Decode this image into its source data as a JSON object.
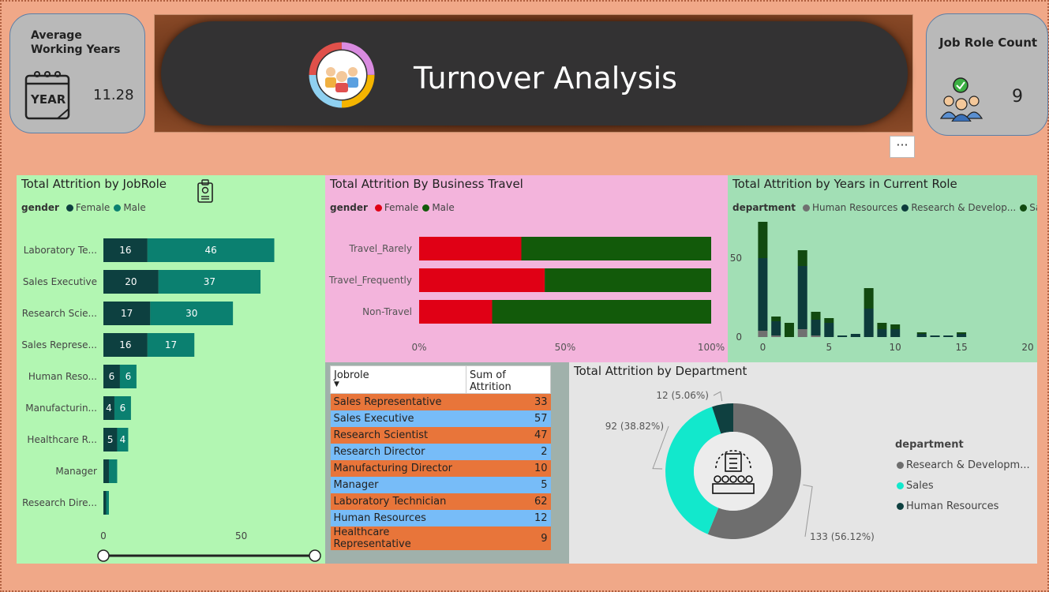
{
  "header": {
    "title": "Turnover Analysis",
    "more_label": "···"
  },
  "kpis": {
    "avg_years": {
      "label": "Average Working Years",
      "value": "11.28",
      "icon": "year-calendar-icon",
      "icon_text": "YEAR"
    },
    "job_role_count": {
      "label": "Job Role Count",
      "value": "9",
      "icon": "team-check-icon"
    }
  },
  "jobrole_chart": {
    "title": "Total Attrition by JobRole",
    "legend_title": "gender",
    "legend": [
      "Female",
      "Male"
    ],
    "colors": {
      "female": "#0d4040",
      "male": "#0b8070",
      "bg": "#b2f6b2"
    }
  },
  "travel_chart": {
    "title": "Total Attrition By Business Travel",
    "legend_title": "gender",
    "legend": [
      "Female",
      "Male"
    ],
    "colors": {
      "female": "#e00015",
      "male": "#125a0a",
      "bg": "#f3b4dc"
    }
  },
  "years_chart": {
    "title": "Total Attrition by Years in Current Role",
    "legend_title": "department",
    "legend": [
      "Human Resources",
      "Research & Develop...",
      "Sales"
    ],
    "colors": {
      "hr": "#707070",
      "rd": "#0d3b3b",
      "sales": "#124a10",
      "bg": "#a2dfb5"
    }
  },
  "table": {
    "headers": [
      "Jobrole",
      "Sum of Attrition"
    ],
    "rows": [
      [
        "Sales Representative",
        "33"
      ],
      [
        "Sales Executive",
        "57"
      ],
      [
        "Research Scientist",
        "47"
      ],
      [
        "Research Director",
        "2"
      ],
      [
        "Manufacturing Director",
        "10"
      ],
      [
        "Manager",
        "5"
      ],
      [
        "Laboratory Technician",
        "62"
      ],
      [
        "Human Resources",
        "12"
      ],
      [
        "Healthcare Representative",
        "9"
      ]
    ]
  },
  "dept_chart": {
    "title": "Total Attrition by Department",
    "legend_title": "department",
    "legend": [
      "Research & Developm...",
      "Sales",
      "Human Resources"
    ],
    "colors": {
      "rd": "#6e6e6e",
      "sales": "#12e8cc",
      "hr": "#0f4040",
      "bg": "#e5e5e5"
    }
  },
  "chart_data": [
    {
      "type": "bar",
      "orientation": "horizontal",
      "stacked": true,
      "title": "Total Attrition by JobRole",
      "categories": [
        "Laboratory Te...",
        "Sales Executive",
        "Research Scie...",
        "Sales Represe...",
        "Human Reso...",
        "Manufacturin...",
        "Healthcare R...",
        "Manager",
        "Research Dire..."
      ],
      "series": [
        {
          "name": "Female",
          "values": [
            16,
            20,
            17,
            16,
            6,
            4,
            5,
            2,
            1
          ]
        },
        {
          "name": "Male",
          "values": [
            46,
            37,
            30,
            17,
            6,
            6,
            4,
            3,
            1
          ]
        }
      ],
      "data_labels": [
        [
          "16",
          "46"
        ],
        [
          "20",
          "37"
        ],
        [
          "17",
          "30"
        ],
        [
          "16",
          "17"
        ],
        [
          "6",
          "6"
        ],
        [
          "4",
          "6"
        ],
        [
          "5",
          "4"
        ],
        [
          "",
          ""
        ],
        [
          "",
          ""
        ]
      ],
      "xticks": [
        "0",
        "50"
      ],
      "xlim": [
        0,
        63
      ]
    },
    {
      "type": "bar",
      "orientation": "horizontal",
      "stacked": "percent",
      "title": "Total Attrition By Business Travel",
      "categories": [
        "Travel_Rarely",
        "Travel_Frequently",
        "Non-Travel"
      ],
      "series": [
        {
          "name": "Female",
          "values": [
            35,
            43,
            25
          ]
        },
        {
          "name": "Male",
          "values": [
            65,
            57,
            75
          ]
        }
      ],
      "xticks": [
        "0%",
        "50%",
        "100%"
      ]
    },
    {
      "type": "bar",
      "stacked": true,
      "title": "Total Attrition by Years in Current Role",
      "x": [
        0,
        1,
        2,
        3,
        4,
        5,
        6,
        7,
        8,
        9,
        10,
        12,
        13,
        14,
        15
      ],
      "series": [
        {
          "name": "Human Resources",
          "values": [
            4,
            1,
            0,
            5,
            1,
            0,
            0,
            0,
            0,
            0,
            0,
            0,
            0,
            0,
            0
          ]
        },
        {
          "name": "Research & Develop...",
          "values": [
            46,
            9,
            0,
            40,
            10,
            9,
            1,
            2,
            18,
            5,
            5,
            2,
            1,
            1,
            2
          ]
        },
        {
          "name": "Sales",
          "values": [
            23,
            3,
            9,
            10,
            5,
            3,
            0,
            0,
            13,
            4,
            3,
            1,
            0,
            0,
            1
          ]
        }
      ],
      "xticks": [
        "0",
        "5",
        "10",
        "15",
        "20"
      ],
      "yticks": [
        "0",
        "50"
      ],
      "xlim": [
        -0.5,
        20
      ],
      "ylim": [
        0,
        75
      ]
    },
    {
      "type": "pie",
      "donut": true,
      "title": "Total Attrition by Department",
      "labels": [
        "Research & Developm...",
        "Sales",
        "Human Resources"
      ],
      "values": [
        133,
        92,
        12
      ],
      "data_labels": [
        "133 (56.12%)",
        "92 (38.82%)",
        "12 (5.06%)"
      ]
    }
  ]
}
